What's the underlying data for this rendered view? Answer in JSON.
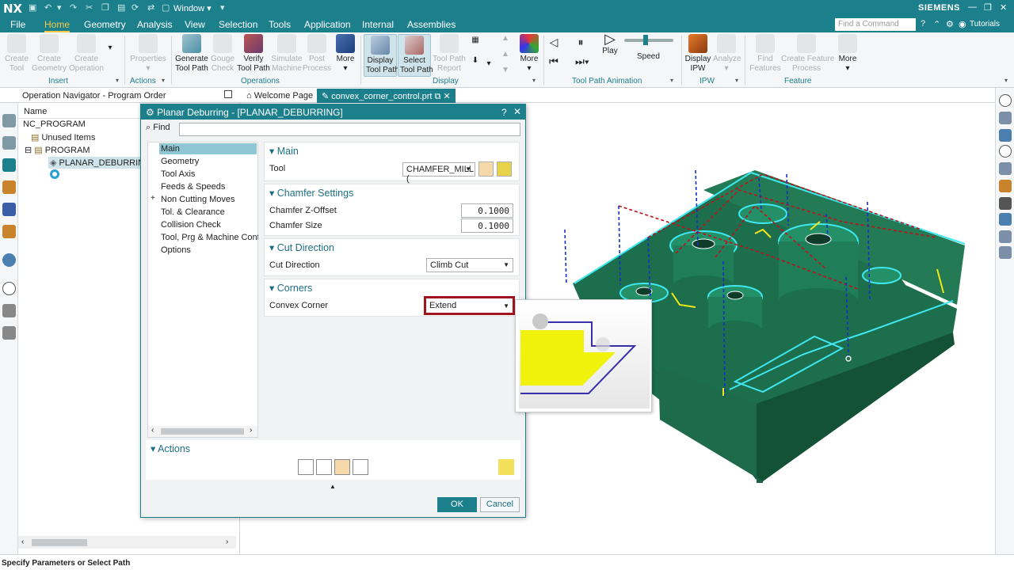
{
  "titlebar": {
    "logo": "NX",
    "window_menu": "Window ▾",
    "brand": "SIEMENS"
  },
  "menubar": {
    "items": [
      "File",
      "Home",
      "Geometry",
      "Analysis",
      "View",
      "Selection",
      "Tools",
      "Application",
      "Internal",
      "Assemblies"
    ],
    "active": "Home",
    "find_command_placeholder": "Find a Command",
    "tutorials": "Tutorials"
  },
  "ribbon": {
    "create_tool": "Create\nTool",
    "create_geometry": "Create\nGeometry",
    "create_operation": "Create\nOperation",
    "properties": "Properties",
    "generate_tool_path": "Generate\nTool Path",
    "gouge_check": "Gouge\nCheck",
    "verify_tool_path": "Verify\nTool Path",
    "simulate_machine": "Simulate\nMachine",
    "post_process": "Post\nProcess",
    "more": "More",
    "display_tool_path": "Display\nTool Path",
    "select_tool_path": "Select\nTool Path",
    "tool_path_report": "Tool Path\nReport",
    "play": "Play",
    "speed": "Speed",
    "display_ipw": "Display\nIPW",
    "analyze": "Analyze",
    "find_features": "Find\nFeatures",
    "create_feature_process": "Create Feature\nProcess",
    "groups": {
      "insert": "Insert",
      "actions": "Actions",
      "operations": "Operations",
      "display": "Display",
      "tool_path_animation": "Tool Path Animation",
      "ipw": "IPW",
      "feature": "Feature"
    }
  },
  "tabs": {
    "navigator_title": "Operation Navigator - Program Order",
    "welcome": "Welcome Page",
    "part": "convex_corner_control.prt"
  },
  "navigator": {
    "column_name": "Name",
    "rows": [
      "NC_PROGRAM",
      "Unused Items",
      "PROGRAM",
      "PLANAR_DEBURRING"
    ]
  },
  "dialog": {
    "title": "Planar Deburring - [PLANAR_DEBURRING]",
    "find_label": "Find",
    "tree_items": [
      "Main",
      "Geometry",
      "Tool Axis",
      "Feeds & Speeds",
      "Non Cutting Moves",
      "Tol. & Clearance",
      "Collision Check",
      "Tool, Prg & Machine Control",
      "Options"
    ],
    "main": {
      "header": "Main",
      "tool_label": "Tool",
      "tool_value": "CHAMFER_MILL ("
    },
    "chamfer": {
      "header": "Chamfer Settings",
      "z_offset_label": "Chamfer Z-Offset",
      "z_offset_value": "0.1000",
      "size_label": "Chamfer Size",
      "size_value": "0.1000"
    },
    "cut": {
      "header": "Cut Direction",
      "label": "Cut Direction",
      "value": "Climb Cut"
    },
    "corners": {
      "header": "Corners",
      "label": "Convex Corner",
      "value": "Extend"
    },
    "actions_header": "Actions",
    "ok": "OK",
    "cancel": "Cancel"
  },
  "statusbar": {
    "text": "Specify Parameters or Select Path"
  },
  "colors": {
    "accent": "#1c7f8c",
    "highlight": "#f7c948",
    "part_green": "#1f7a55",
    "toolpath_cyan": "#3fe7f0",
    "toolpath_red": "#c0101a",
    "toolpath_blue": "#1530c8",
    "dropdown_highlight": "#a0141e"
  }
}
